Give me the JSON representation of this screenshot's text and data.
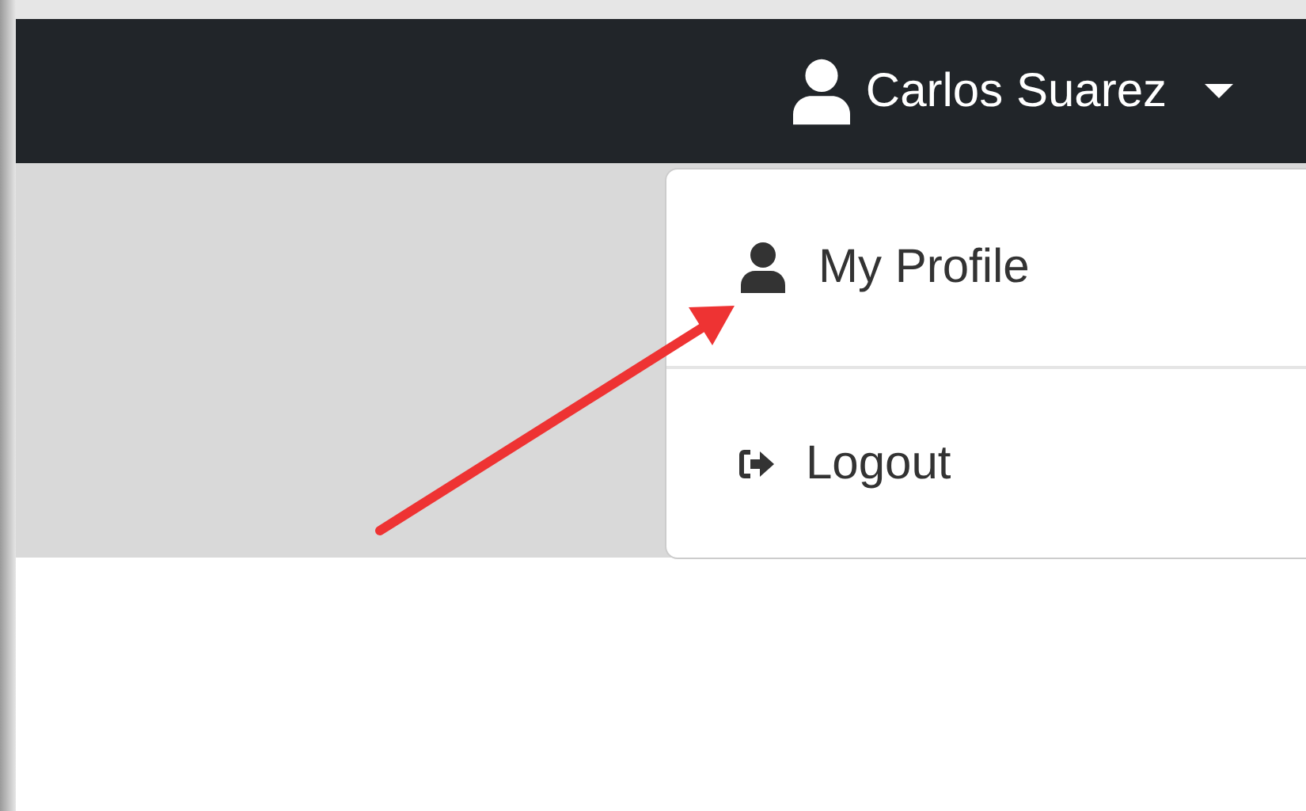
{
  "navbar": {
    "user_name": "Carlos Suarez",
    "expanded": true
  },
  "menu": [
    {
      "label": "My Profile",
      "kind": "profile"
    },
    {
      "label": "Logout",
      "kind": "logout"
    }
  ],
  "annotation": {
    "kind": "arrow"
  }
}
